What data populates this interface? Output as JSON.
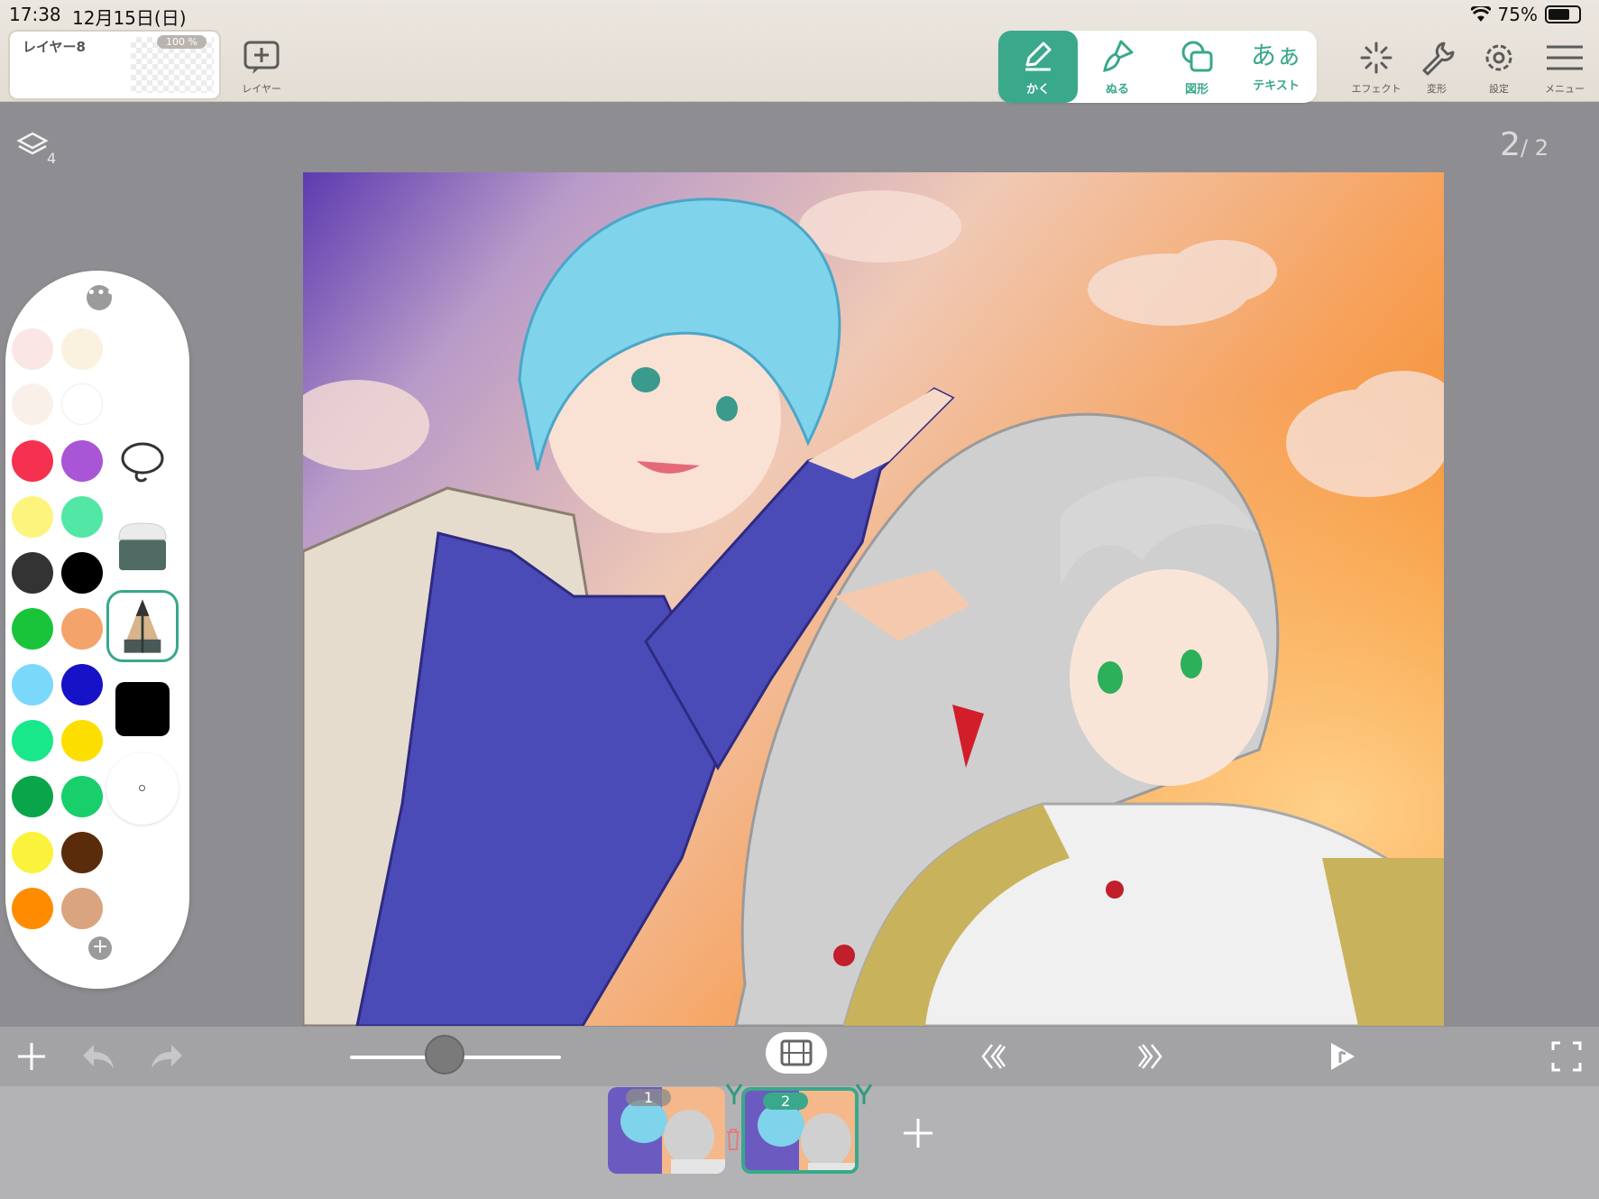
{
  "status_bar": {
    "time": "17:38",
    "date": "12月15日(日)",
    "battery": "75%"
  },
  "layer_card": {
    "name": "レイヤー8",
    "opacity": "100 %"
  },
  "toolbar": {
    "add_layer_label": "レイヤー",
    "tools": [
      {
        "label": "かく",
        "icon": "pencil-icon",
        "active": true
      },
      {
        "label": "ぬる",
        "icon": "brush-icon",
        "active": false
      },
      {
        "label": "図形",
        "icon": "shapes-icon",
        "active": false
      },
      {
        "label": "テキスト",
        "glyph": "あぁ",
        "icon": "text-icon",
        "active": false
      }
    ],
    "right_tools": [
      {
        "label": "エフェクト",
        "icon": "sparkle-icon"
      },
      {
        "label": "変形",
        "icon": "wrench-icon"
      },
      {
        "label": "設定",
        "icon": "gear-icon"
      },
      {
        "label": "メニュー",
        "icon": "hamburger-icon"
      }
    ]
  },
  "canvas": {
    "layer_count": "4",
    "frame_current": "2",
    "frame_total": "/ 2"
  },
  "palette": {
    "more": "•••",
    "add": "+",
    "colors": [
      "#fbe6e6",
      "#fbf1df",
      "#faf0ea",
      "#ffffff",
      "#f5314f",
      "#a855d6",
      "#fdf47e",
      "#52e7a4",
      "#333333",
      "#000000",
      "#19c43a",
      "#f4a36b",
      "#7ad8fb",
      "#1512c8",
      "#18e88a",
      "#fcdf00",
      "#0aa54a",
      "#19cf6c",
      "#fbf23c",
      "#5a2c0c",
      "#ff8c00",
      "#d9a47e"
    ],
    "current_color": "#000000"
  },
  "bottom_bar": {
    "brush_size_fraction": 0.45
  },
  "timeline": {
    "frames": [
      {
        "label": "1"
      },
      {
        "label": "2"
      }
    ],
    "add": "+"
  }
}
